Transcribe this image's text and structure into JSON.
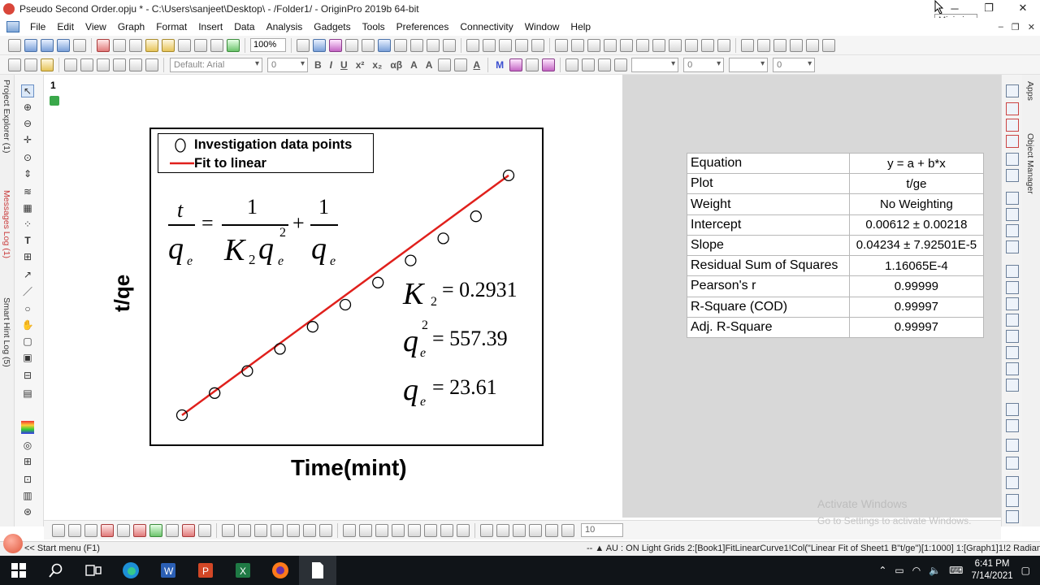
{
  "window": {
    "title": "Pseudo Second Order.opju * - C:\\Users\\sanjeet\\Desktop\\ - /Folder1/ - OriginPro 2019b 64-bit",
    "minimize_tooltip": "Minimize"
  },
  "menu": [
    "File",
    "Edit",
    "View",
    "Graph",
    "Format",
    "Insert",
    "Data",
    "Analysis",
    "Gadgets",
    "Tools",
    "Preferences",
    "Connectivity",
    "Window",
    "Help"
  ],
  "toolbar": {
    "zoom": "100%",
    "font_name": "Default: Arial",
    "font_size": "0",
    "line_width": "0",
    "line_width2": "0"
  },
  "left_tabs": [
    "Project Explorer (1)",
    "Messages Log (1)",
    "Smart Hint Log (5)"
  ],
  "right_tabs": [
    "Apps",
    "Object Manager"
  ],
  "layer": "1",
  "graph": {
    "legend": [
      {
        "symbol": "circle",
        "label": "Investigation data points"
      },
      {
        "symbol": "red-line",
        "label": "Fit to linear"
      }
    ],
    "ylabel": "t/qe",
    "xlabel": "Time(mint)",
    "equation": {
      "t": "t",
      "qe": "q",
      "e_sub": "e",
      "equals": "=",
      "one": "1",
      "plus": "+",
      "K": "K",
      "two": "2"
    },
    "params": {
      "K2_value": "= 0.2931",
      "qe2_value": "= 557.39",
      "qe_value": "= 23.61"
    }
  },
  "chart_data": {
    "type": "scatter",
    "series": [
      {
        "name": "Investigation data points",
        "x": [
          0,
          1,
          2,
          3,
          4,
          5,
          6,
          7,
          8,
          9,
          10
        ],
        "y": [
          0,
          1,
          2,
          3,
          4,
          5,
          6,
          7,
          8,
          9,
          10.85
        ]
      },
      {
        "name": "Fit to linear",
        "type": "line",
        "x": [
          0,
          10
        ],
        "y": [
          0,
          10.85
        ]
      }
    ],
    "xlabel": "Time(mint)",
    "ylabel": "t/qe",
    "grid": false,
    "legend_position": "top-left"
  },
  "fit_table": {
    "rows": [
      {
        "label": "Equation",
        "value": "y = a + b*x"
      },
      {
        "label": "Plot",
        "value": "t/ge"
      },
      {
        "label": "Weight",
        "value": "No Weighting"
      },
      {
        "label": "Intercept",
        "value": "0.00612 ± 0.00218"
      },
      {
        "label": "Slope",
        "value": "0.04234 ± 7.92501E-5"
      },
      {
        "label": "Residual Sum of Squares",
        "value": "1.16065E-4"
      },
      {
        "label": "Pearson's r",
        "value": "0.99999"
      },
      {
        "label": "R-Square (COD)",
        "value": "0.99997"
      },
      {
        "label": "Adj. R-Square",
        "value": "0.99997"
      }
    ]
  },
  "bottom_toolbar": {
    "value": "10"
  },
  "status": {
    "left": "<< Start menu (F1)",
    "right": "-- ▲ AU : ON  Light Grids  2:[Book1]FitLinearCurve1!Col(\"Linear Fit of Sheet1 B\"t/ge\")[1:1000]  1:[Graph1]1!2  Radian"
  },
  "watermark": {
    "line1": "Activate Windows",
    "line2": "Go to Settings to activate Windows."
  },
  "taskbar": {
    "time": "6:41 PM",
    "date": "7/14/2021"
  }
}
